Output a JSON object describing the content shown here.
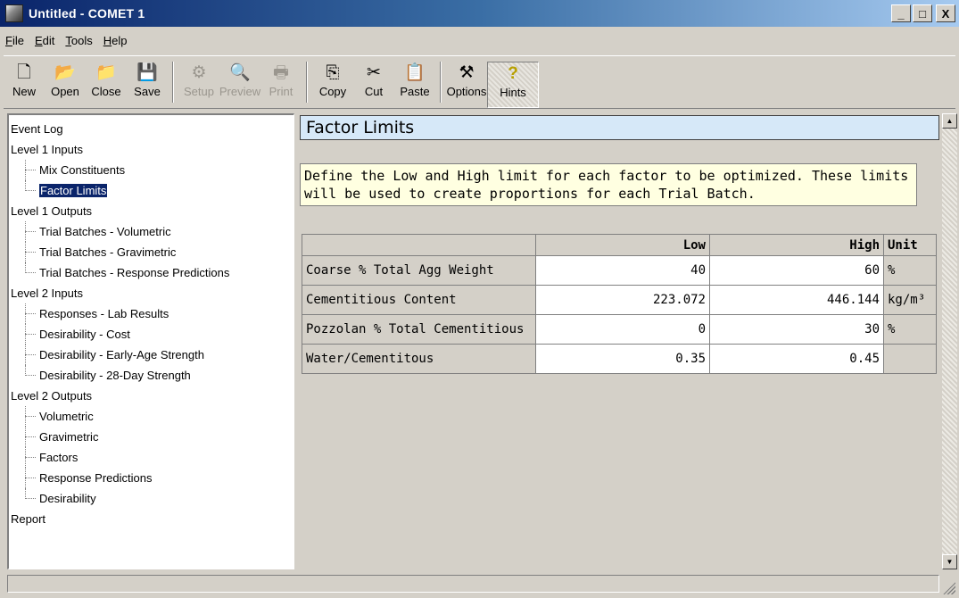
{
  "window": {
    "title": "Untitled - COMET 1",
    "min": "_",
    "max": "□",
    "close": "X"
  },
  "menu": [
    {
      "label": "File",
      "acc": "F",
      "rest": "ile"
    },
    {
      "label": "Edit",
      "acc": "E",
      "rest": "dit"
    },
    {
      "label": "Tools",
      "acc": "T",
      "rest": "ools"
    },
    {
      "label": "Help",
      "acc": "H",
      "rest": "elp"
    }
  ],
  "toolbar": {
    "new": {
      "label": "New",
      "icon": "new-document-icon",
      "glyph": "🗋"
    },
    "open": {
      "label": "Open",
      "icon": "open-folder-icon",
      "glyph": "📂"
    },
    "close": {
      "label": "Close",
      "icon": "close-folder-icon",
      "glyph": "📁"
    },
    "save": {
      "label": "Save",
      "icon": "floppy-disk-icon",
      "glyph": "💾"
    },
    "setup": {
      "label": "Setup",
      "icon": "printer-setup-icon",
      "glyph": "⚙"
    },
    "preview": {
      "label": "Preview",
      "icon": "print-preview-icon",
      "glyph": "🔍"
    },
    "print": {
      "label": "Print",
      "icon": "printer-icon",
      "glyph": "🖶"
    },
    "copy": {
      "label": "Copy",
      "icon": "copy-icon",
      "glyph": "⎘"
    },
    "cut": {
      "label": "Cut",
      "icon": "scissors-icon",
      "glyph": "✂"
    },
    "paste": {
      "label": "Paste",
      "icon": "clipboard-icon",
      "glyph": "📋"
    },
    "options": {
      "label": "Options",
      "icon": "tools-icon",
      "glyph": "⚒"
    },
    "hints": {
      "label": "Hints",
      "icon": "question-icon",
      "glyph": "?"
    }
  },
  "tree": {
    "event_log": "Event Log",
    "l1_inputs": "Level 1 Inputs",
    "mix_constituents": "Mix Constituents",
    "factor_limits": "Factor Limits",
    "l1_outputs": "Level 1 Outputs",
    "tb_volumetric": "Trial Batches - Volumetric",
    "tb_gravimetric": "Trial Batches - Gravimetric",
    "tb_response": "Trial Batches - Response Predictions",
    "l2_inputs": "Level 2 Inputs",
    "responses_lab": "Responses - Lab Results",
    "des_cost": "Desirability - Cost",
    "des_early": "Desirability - Early-Age Strength",
    "des_28day": "Desirability - 28-Day Strength",
    "l2_outputs": "Level 2 Outputs",
    "volumetric": "Volumetric",
    "gravimetric": "Gravimetric",
    "factors": "Factors",
    "response_predictions": "Response Predictions",
    "desirability": "Desirability",
    "report": "Report"
  },
  "content": {
    "header": "Factor Limits",
    "info_line1": "Define the Low and High limit for each factor to be optimized. These limits",
    "info_line2": "will be used to create proportions for each Trial Batch."
  },
  "table": {
    "headers": {
      "corner": "",
      "low": "Low",
      "high": "High",
      "unit": "Unit"
    },
    "rows": [
      {
        "name": "Coarse % Total Agg Weight",
        "low": "40",
        "high": "60",
        "unit": "%"
      },
      {
        "name": "Cementitious Content",
        "low": "223.072",
        "high": "446.144",
        "unit": "kg/m³"
      },
      {
        "name": "Pozzolan % Total Cementitious",
        "low": "0",
        "high": "30",
        "unit": "%"
      },
      {
        "name": "Water/Cementitous",
        "low": "0.35",
        "high": "0.45",
        "unit": ""
      }
    ]
  }
}
